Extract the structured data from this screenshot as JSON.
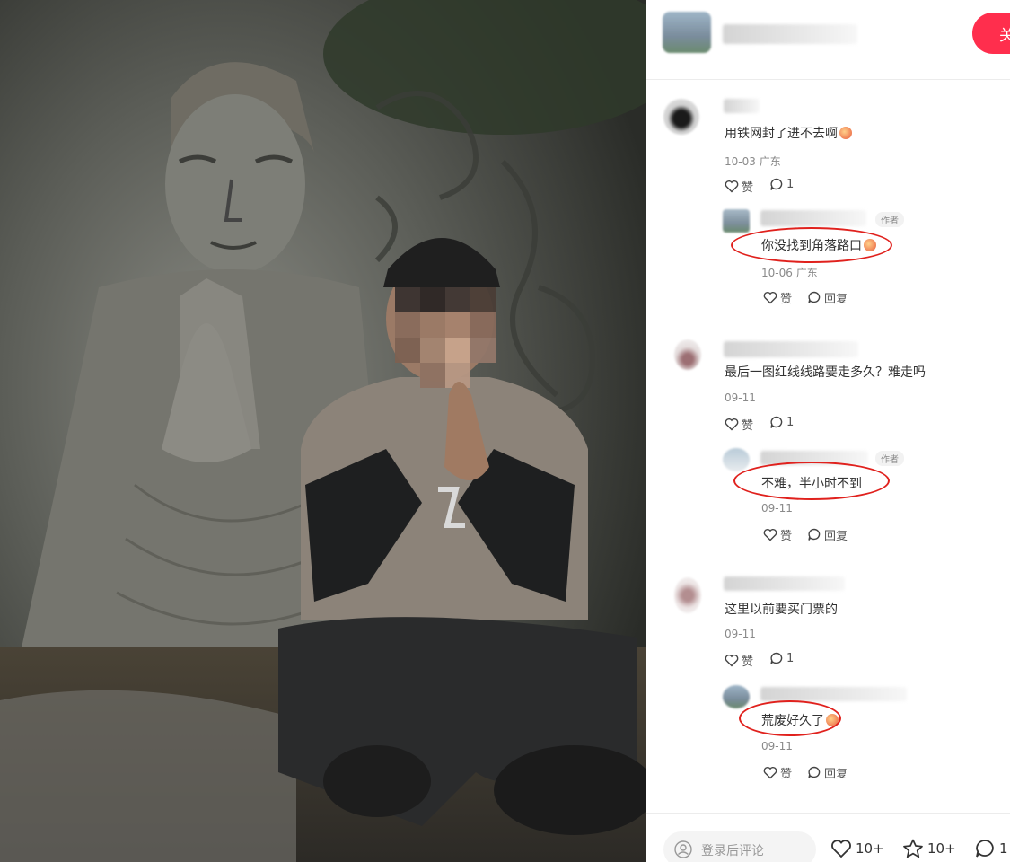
{
  "photo": {
    "alt_colors": {
      "stone": "#5b5d57",
      "dark": "#2a2c28"
    }
  },
  "header": {
    "follow_label": "关"
  },
  "comments": [
    {
      "text": "用铁网封了进不去啊",
      "date": "10-03",
      "region": "广东",
      "like_label": "赞",
      "reply_count": "1",
      "reply": {
        "author_tag": "作者",
        "text": "你没找到角落路口",
        "date": "10-06",
        "region": "广东",
        "like_label": "赞",
        "reply_label": "回复"
      }
    },
    {
      "text": "最后一图红线线路要走多久？难走吗",
      "date": "09-11",
      "like_label": "赞",
      "reply_count": "1",
      "reply": {
        "author_tag": "作者",
        "text": "不难，半小时不到",
        "date": "09-11",
        "like_label": "赞",
        "reply_label": "回复"
      }
    },
    {
      "text": "这里以前要买门票的",
      "date": "09-11",
      "like_label": "赞",
      "reply_count": "1",
      "reply": {
        "text": "荒废好久了",
        "date": "09-11",
        "like_label": "赞",
        "reply_label": "回复"
      }
    }
  ],
  "bottom_bar": {
    "comment_placeholder": "登录后评论",
    "likes": "10+",
    "stars": "10+",
    "comments": "1"
  },
  "colors": {
    "accent": "#ff2e4d",
    "annotation": "#e0211d"
  }
}
